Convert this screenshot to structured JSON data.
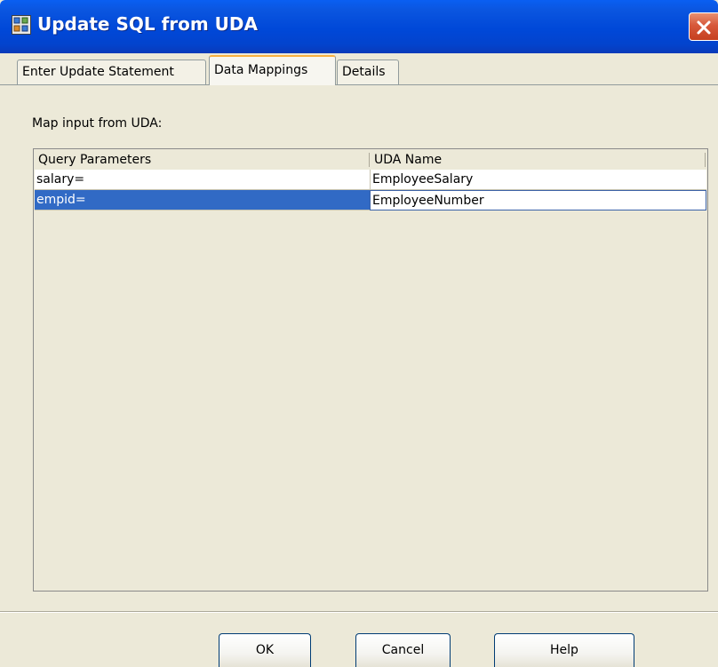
{
  "window": {
    "title": "Update SQL from UDA"
  },
  "tabs": [
    {
      "label": "Enter Update Statement"
    },
    {
      "label": "Data Mappings",
      "active": true
    },
    {
      "label": "Details"
    }
  ],
  "mapping": {
    "label": "Map input from UDA:",
    "columns": [
      "Query Parameters",
      "UDA Name"
    ],
    "rows": [
      {
        "param": "salary=",
        "uda": "EmployeeSalary"
      },
      {
        "param": "empid=",
        "uda": "EmployeeNumber",
        "selected": true
      }
    ]
  },
  "buttons": {
    "ok": "OK",
    "cancel": "Cancel",
    "help": "Help"
  },
  "colors": {
    "title_bar": "#0048d8",
    "selection": "#316ac5",
    "tab_highlight": "#f8b040",
    "dialog_bg": "#ece9d8"
  }
}
